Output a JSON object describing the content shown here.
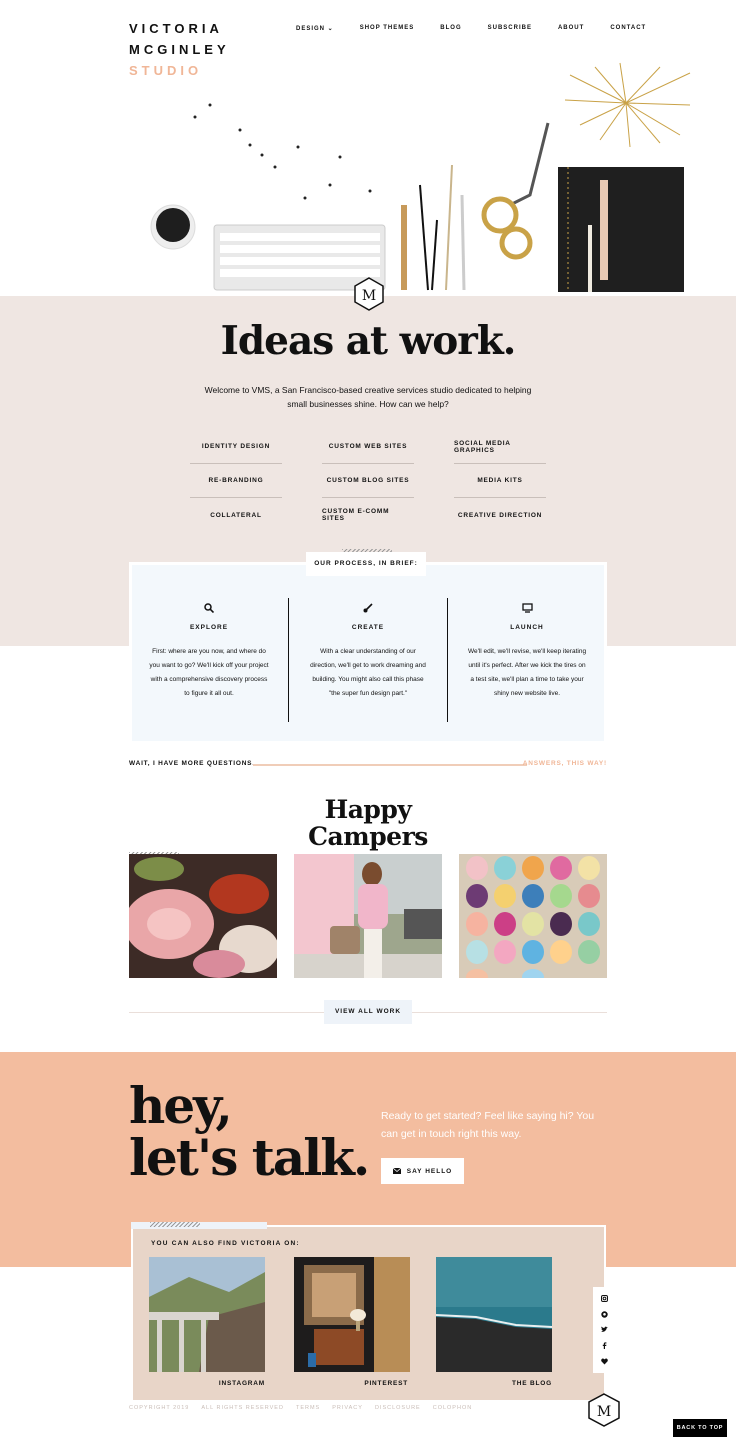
{
  "logo": {
    "line1": "VICTORIA",
    "line2": "MCGINLEY",
    "line3": "STUDIO"
  },
  "nav": {
    "items": [
      "DESIGN ⌄",
      "SHOP THEMES",
      "BLOG",
      "SUBSCRIBE",
      "ABOUT",
      "CONTACT"
    ]
  },
  "hero_badge": "M",
  "ideas": {
    "title": "Ideas at work.",
    "intro": "Welcome to VMS, a San Francisco-based creative services studio dedicated to helping small businesses shine. How can we help?",
    "services": [
      "IDENTITY DESIGN",
      "CUSTOM WEB SITES",
      "SOCIAL MEDIA GRAPHICS",
      "RE-BRANDING",
      "CUSTOM BLOG SITES",
      "MEDIA KITS",
      "COLLATERAL",
      "CUSTOM E-COMM SITES",
      "CREATIVE DIRECTION"
    ]
  },
  "process": {
    "tag": "OUR PROCESS, IN BRIEF:",
    "steps": [
      {
        "icon": "search-icon",
        "title": "EXPLORE",
        "text": "First: where are you now, and where do you want to go? We'll kick off your project with a comprehensive discovery process to figure it all out."
      },
      {
        "icon": "brush-icon",
        "title": "CREATE",
        "text": "With a clear understanding of our direction, we'll get to work dreaming and building. You might also call this phase \"the super fun design part.\""
      },
      {
        "icon": "monitor-icon",
        "title": "LAUNCH",
        "text": "We'll edit, we'll revise, we'll keep iterating until it's perfect. After we kick the tires on a test site, we'll plan a time to take your shiny new website live."
      }
    ],
    "more_left": "WAIT, I HAVE MORE QUESTIONS.",
    "more_right": "ANSWERS, THIS WAY!"
  },
  "campers": {
    "title_line1": "Happy",
    "title_line2": "Campers",
    "button": "VIEW ALL WORK"
  },
  "talk": {
    "hey_line1": "hey,",
    "hey_line2": "let's talk.",
    "ready": "Ready to get started? Feel like saying hi? You can get in touch right this way.",
    "button": "SAY HELLO"
  },
  "social": {
    "label": "YOU CAN ALSO FIND VICTORIA ON:",
    "items": [
      "INSTAGRAM",
      "PINTEREST",
      "THE BLOG"
    ]
  },
  "footer": {
    "links": [
      "COPYRIGHT 2019",
      "ALL RIGHTS RESERVED",
      "TERMS",
      "PRIVACY",
      "DISCLOSURE",
      "COLOPHON"
    ],
    "back_to_top": "BACK TO TOP"
  },
  "colors": {
    "accent": "#f0b697",
    "blush": "#efe6e2",
    "peach": "#f3bd9f"
  }
}
